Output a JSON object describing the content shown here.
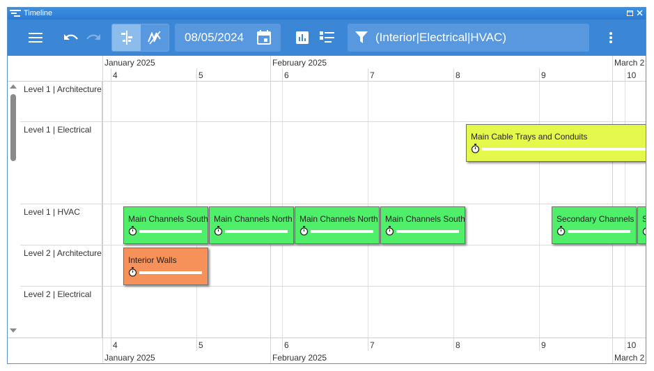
{
  "window": {
    "title": "Timeline"
  },
  "toolbar": {
    "date_value": "08/05/2024",
    "filter_value": "(Interior|Electrical|HVAC)"
  },
  "months": [
    "January 2025",
    "February 2025",
    "March 2"
  ],
  "weeks": [
    "4",
    "5",
    "6",
    "7",
    "8",
    "9",
    "10"
  ],
  "rows": [
    {
      "label": "Level 1 | Architecture"
    },
    {
      "label": "Level 1 | Electrical"
    },
    {
      "label": "Level 1 | HVAC"
    },
    {
      "label": "Level 2 | Architecture"
    },
    {
      "label": "Level 2 | Electrical"
    }
  ],
  "tasks": [
    {
      "name": "Main Cable Trays and Conduits",
      "row": "Level 1 | Electrical",
      "color": "#e4f84c"
    },
    {
      "name": "Main Channels South",
      "row": "Level 1 | HVAC",
      "color": "#4fef6a"
    },
    {
      "name": "Main Channels North",
      "row": "Level 1 | HVAC",
      "color": "#4fef6a"
    },
    {
      "name": "Main Channels North",
      "row": "Level 1 | HVAC",
      "color": "#4fef6a"
    },
    {
      "name": "Main Channels South",
      "row": "Level 1 | HVAC",
      "color": "#4fef6a"
    },
    {
      "name": "Secondary Channels S",
      "row": "Level 1 | HVAC",
      "color": "#4fef6a"
    },
    {
      "name": "S",
      "row": "Level 1 | HVAC",
      "color": "#4fef6a"
    },
    {
      "name": "Interior Walls",
      "row": "Level 2 | Architecture",
      "color": "#f7915a"
    }
  ],
  "icons": [
    "menu-icon",
    "undo-icon",
    "redo-icon",
    "gantt-view-icon",
    "no-dependencies-icon",
    "calendar-icon",
    "bar-chart-icon",
    "list-view-icon",
    "filter-icon",
    "more-vertical-icon",
    "timer-icon"
  ]
}
